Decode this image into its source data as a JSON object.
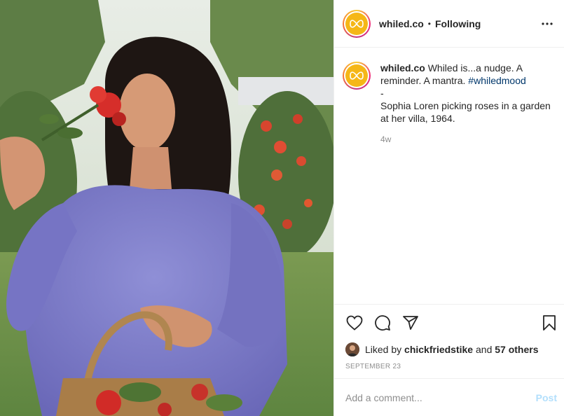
{
  "account": {
    "username": "whiled.co",
    "separator": "•",
    "follow_status": "Following"
  },
  "caption": {
    "username": "whiled.co",
    "text_part1": "Whiled is...a nudge. A reminder. A mantra.",
    "hashtag": "#whiledmood",
    "dash": "-",
    "text_part2": "Sophia Loren picking roses in a garden at her villa, 1964.",
    "time": "4w"
  },
  "likes": {
    "prefix": "Liked by",
    "user": "chickfriedstike",
    "and": "and",
    "others": "57 others"
  },
  "date": "September 23",
  "comment": {
    "placeholder": "Add a comment...",
    "post_label": "Post"
  },
  "icons": {
    "more": "more-options-icon",
    "like": "heart-icon",
    "comment": "comment-bubble-icon",
    "share": "paper-plane-icon",
    "save": "bookmark-icon",
    "logo": "bow-logo-icon"
  },
  "colors": {
    "text": "#262626",
    "muted": "#8e8e8e",
    "hashtag": "#00376b",
    "post_button": "#b2dffc",
    "logo_yellow": "#f5b717"
  }
}
